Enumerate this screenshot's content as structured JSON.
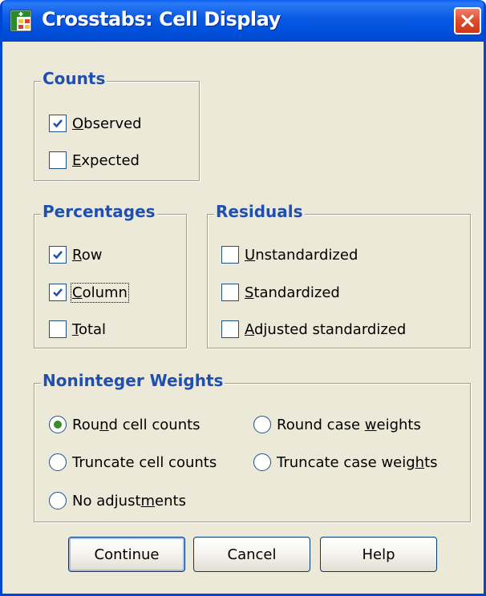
{
  "window": {
    "title": "Crosstabs: Cell Display"
  },
  "counts": {
    "legend": "Counts",
    "observed": {
      "pre": "",
      "key": "O",
      "post": "bserved",
      "checked": true
    },
    "expected": {
      "pre": "",
      "key": "E",
      "post": "xpected",
      "checked": false
    }
  },
  "percentages": {
    "legend": "Percentages",
    "row": {
      "pre": "",
      "key": "R",
      "post": "ow",
      "checked": true
    },
    "column": {
      "pre": "",
      "key": "C",
      "post": "olumn",
      "checked": true
    },
    "total": {
      "pre": "",
      "key": "T",
      "post": "otal",
      "checked": false
    }
  },
  "residuals": {
    "legend": "Residuals",
    "unstandardized": {
      "pre": "",
      "key": "U",
      "post": "nstandardized",
      "checked": false
    },
    "standardized": {
      "pre": "",
      "key": "S",
      "post": "tandardized",
      "checked": false
    },
    "adjusted": {
      "pre": "",
      "key": "A",
      "post": "djusted standardized",
      "checked": false
    }
  },
  "weights": {
    "legend": "Noninteger Weights",
    "round_cell": {
      "pre": "Rou",
      "key": "n",
      "post": "d cell counts",
      "selected": true
    },
    "round_case": {
      "pre": "Round case ",
      "key": "w",
      "post": "eights",
      "selected": false
    },
    "truncate_cell": {
      "pre": "Truncate cell counts",
      "key": "",
      "post": "",
      "selected": false
    },
    "truncate_case": {
      "pre": "Truncate case weig",
      "key": "h",
      "post": "ts",
      "selected": false
    },
    "no_adjust": {
      "pre": "No adjust",
      "key": "m",
      "post": "ents",
      "selected": false
    }
  },
  "buttons": {
    "continue": "Continue",
    "cancel": "Cancel",
    "help": "Help"
  },
  "colors": {
    "accent": "#1f4fb0",
    "titlebar": "#0054e3",
    "close": "#e0502f",
    "radio_dot": "#3a8d2a"
  },
  "icons": {
    "app": "crosstabs-table-icon",
    "close": "close-x-icon",
    "check": "checkmark-icon"
  }
}
